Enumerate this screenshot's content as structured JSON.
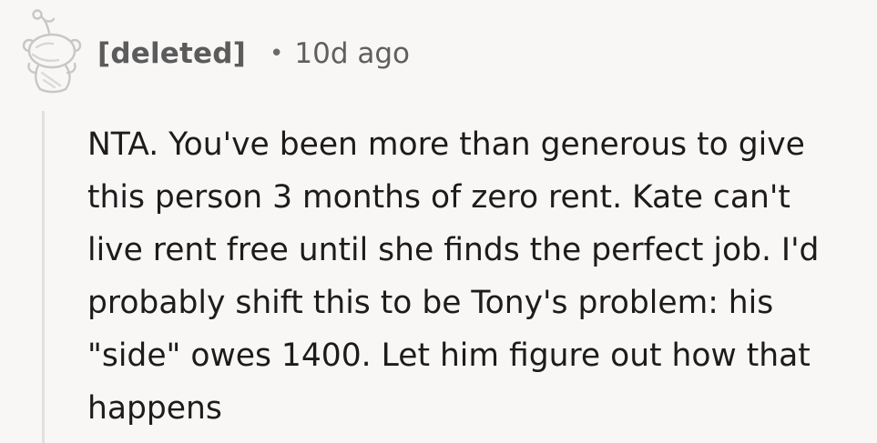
{
  "comment": {
    "author": "[deleted]",
    "separator": "•",
    "timestamp": "10d ago",
    "avatar_icon": "snoo-avatar-icon",
    "body_lines": [
      "NTA. You've been more than generous to give",
      "this person 3 months of zero rent. Kate can't",
      "live rent free until she finds the perfect job. I'd",
      "probably shift this to be Tony's problem: his",
      "\"side\" owes 1400. Let him figure out how that",
      "happens"
    ]
  },
  "colors": {
    "background": "#f9f7f6",
    "text": "#1c1c1c",
    "meta_text": "#5b5b5b",
    "thread_line": "#e3e1df"
  }
}
